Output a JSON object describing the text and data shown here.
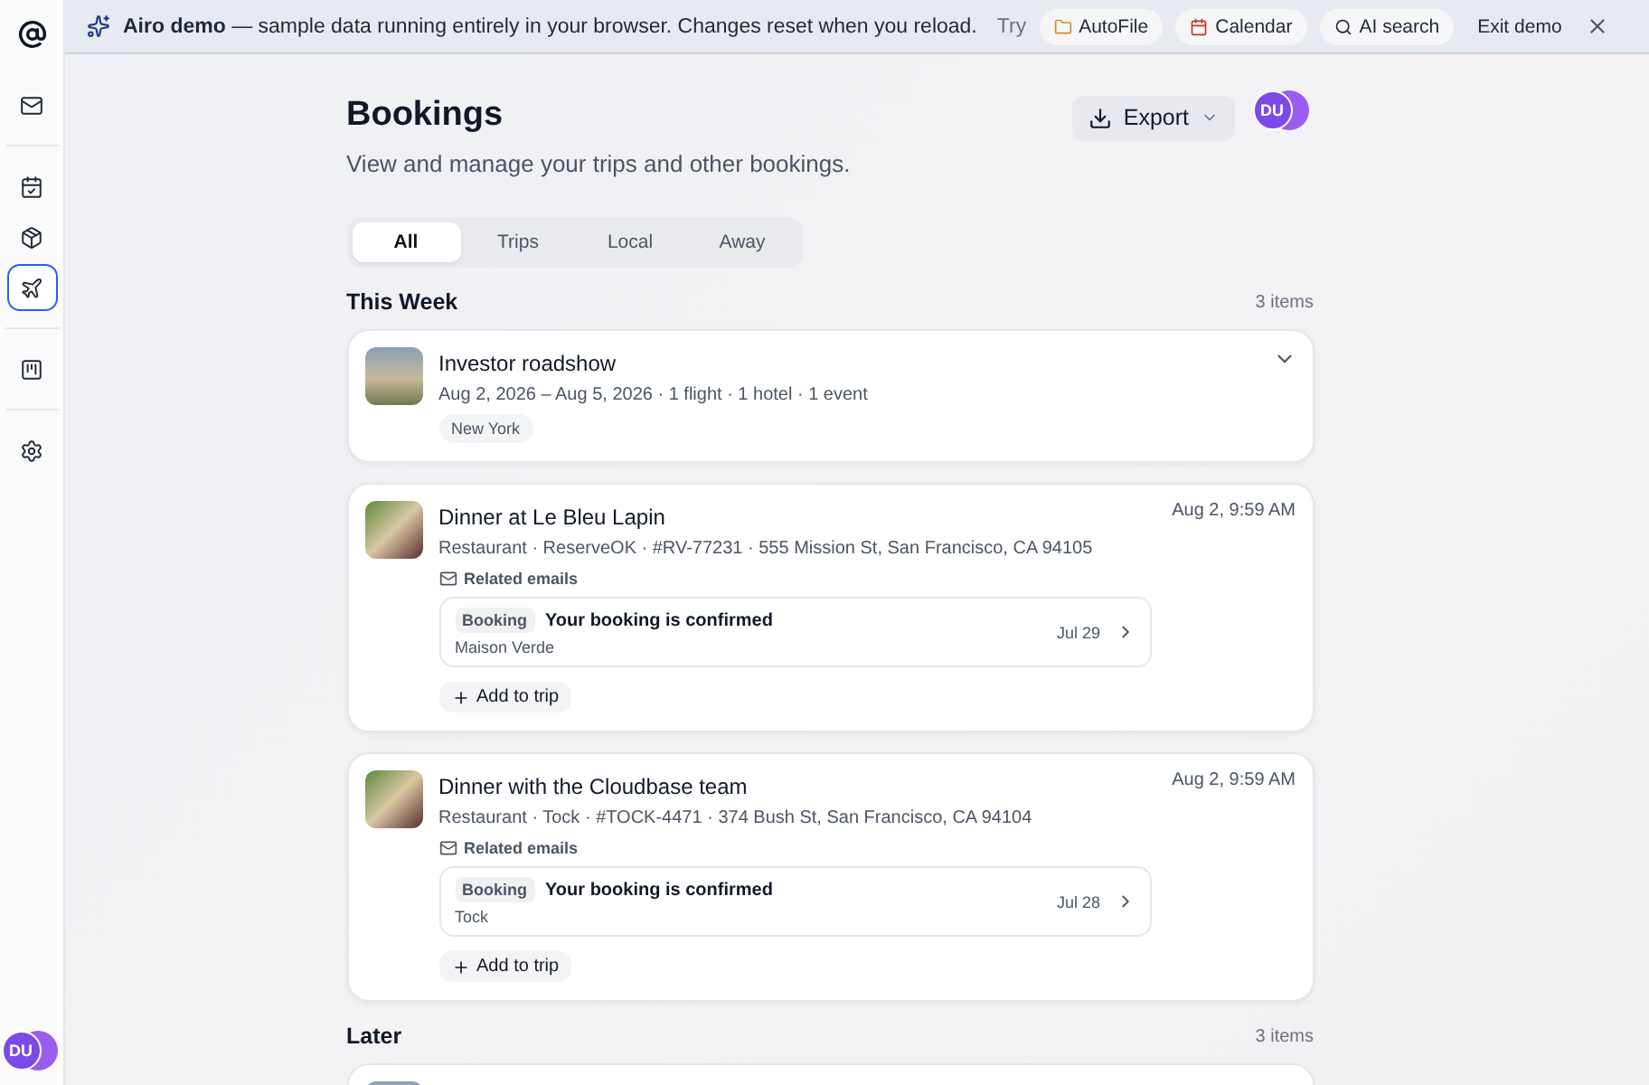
{
  "banner": {
    "title": "Airo demo",
    "message": " — sample data running entirely in your browser. Changes reset when you reload.",
    "try_label": "Try",
    "actions": [
      {
        "label": "AutoFile",
        "kind": "folder"
      },
      {
        "label": "Calendar",
        "kind": "calendar"
      },
      {
        "label": "AI search",
        "kind": "search"
      }
    ],
    "exit": "Exit demo"
  },
  "sidebar": {
    "items": [
      {
        "kind": "mail",
        "selected": false
      },
      {
        "kind": "calendar",
        "selected": false
      },
      {
        "kind": "package",
        "selected": false
      },
      {
        "kind": "plane",
        "selected": true
      },
      {
        "kind": "board",
        "selected": false
      },
      {
        "kind": "settings",
        "selected": false
      }
    ],
    "avatar": "DU"
  },
  "header": {
    "title": "Bookings",
    "subtitle": "View and manage your trips and other bookings.",
    "export": "Export",
    "avatar": "DU"
  },
  "tabs": [
    {
      "label": "All",
      "selected": true
    },
    {
      "label": "Trips",
      "selected": false
    },
    {
      "label": "Local",
      "selected": false
    },
    {
      "label": "Away",
      "selected": false
    }
  ],
  "sections": [
    {
      "title": "This Week",
      "count": "3 items",
      "cards": [
        {
          "kind": "trip",
          "title": "Investor roadshow",
          "dates": "Aug 2, 2026 – Aug 5, 2026  ·  1 flight · 1 hotel · 1 event",
          "tag": "New York",
          "expanded": false
        },
        {
          "kind": "booking",
          "title": "Dinner at Le Bleu Lapin",
          "time": "Aug 2, 9:59 AM",
          "details": "Restaurant  ·  ReserveOK  ·  #RV-77231  ·  555 Mission St, San Francisco, CA 94105",
          "related_label": "Related emails",
          "email": {
            "badge": "Booking",
            "subject": "Your booking is confirmed",
            "sender": "Maison Verde",
            "date": "Jul 29"
          },
          "add": "Add to trip"
        },
        {
          "kind": "booking",
          "title": "Dinner with the Cloudbase team",
          "time": "Aug 2, 9:59 AM",
          "details": "Restaurant  ·  Tock  ·  #TOCK-4471  ·  374 Bush St, San Francisco, CA 94104",
          "related_label": "Related emails",
          "email": {
            "badge": "Booking",
            "subject": "Your booking is confirmed",
            "sender": "Tock",
            "date": "Jul 28"
          },
          "add": "Add to trip"
        }
      ]
    },
    {
      "title": "Later",
      "count": "3 items",
      "cards": [
        {
          "kind": "partial"
        }
      ]
    }
  ]
}
